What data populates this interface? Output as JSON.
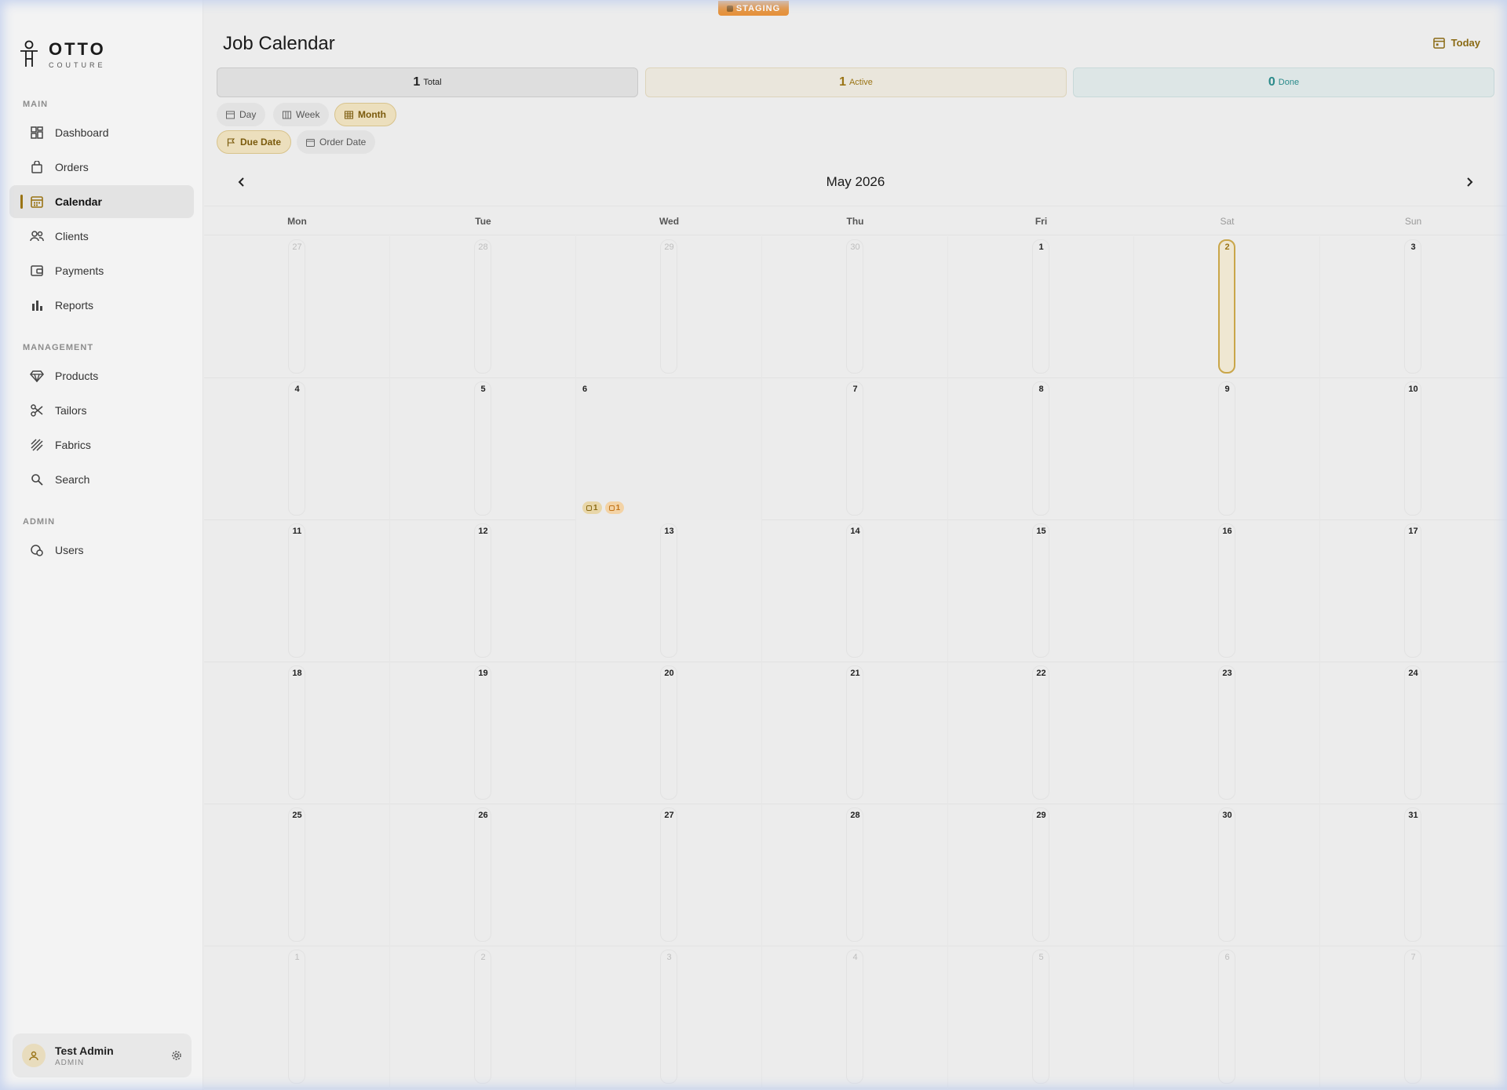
{
  "env_badge": "STAGING",
  "brand": {
    "name": "OTTO",
    "tagline": "COUTURE"
  },
  "sidebar": {
    "sections": [
      {
        "label": "MAIN"
      },
      {
        "label": "MANAGEMENT"
      },
      {
        "label": "ADMIN"
      }
    ],
    "items": [
      {
        "label": "Dashboard",
        "icon": "grid-icon"
      },
      {
        "label": "Orders",
        "icon": "shopping-bag-icon"
      },
      {
        "label": "Calendar",
        "icon": "calendar-icon",
        "active": true
      },
      {
        "label": "Clients",
        "icon": "users-icon"
      },
      {
        "label": "Payments",
        "icon": "wallet-icon"
      },
      {
        "label": "Reports",
        "icon": "bar-chart-icon"
      },
      {
        "label": "Products",
        "icon": "diamond-icon"
      },
      {
        "label": "Tailors",
        "icon": "scissors-icon"
      },
      {
        "label": "Fabrics",
        "icon": "fabric-stripes-icon"
      },
      {
        "label": "Search",
        "icon": "search-icon"
      },
      {
        "label": "Users",
        "icon": "user-shield-icon"
      }
    ]
  },
  "user": {
    "name": "Test Admin",
    "role": "ADMIN"
  },
  "header": {
    "title": "Job Calendar",
    "today_label": "Today"
  },
  "stats": {
    "total": {
      "value": "1",
      "label": "Total"
    },
    "active": {
      "value": "1",
      "label": "Active"
    },
    "done": {
      "value": "0",
      "label": "Done"
    }
  },
  "view_modes": {
    "day": "Day",
    "week": "Week",
    "month": "Month",
    "selected": "Month"
  },
  "date_modes": {
    "due": "Due Date",
    "order": "Order Date",
    "selected": "Due Date"
  },
  "calendar": {
    "month_label": "May 2026",
    "weekdays": [
      "Mon",
      "Tue",
      "Wed",
      "Thu",
      "Fri",
      "Sat",
      "Sun"
    ],
    "weeks": [
      [
        "27",
        "28",
        "29",
        "30",
        "1",
        "2",
        "3"
      ],
      [
        "4",
        "5",
        "6",
        "7",
        "8",
        "9",
        "10"
      ],
      [
        "11",
        "12",
        "13",
        "14",
        "15",
        "16",
        "17"
      ],
      [
        "18",
        "19",
        "20",
        "21",
        "22",
        "23",
        "24"
      ],
      [
        "25",
        "26",
        "27",
        "28",
        "29",
        "30",
        "31"
      ],
      [
        "1",
        "2",
        "3",
        "4",
        "5",
        "6",
        "7"
      ]
    ],
    "today": "2",
    "event_day": "6",
    "event_chips": [
      "1",
      "1"
    ]
  },
  "colors": {
    "accent": "#9a7415",
    "staging": "#e5913a",
    "done": "#2a8a8a"
  }
}
